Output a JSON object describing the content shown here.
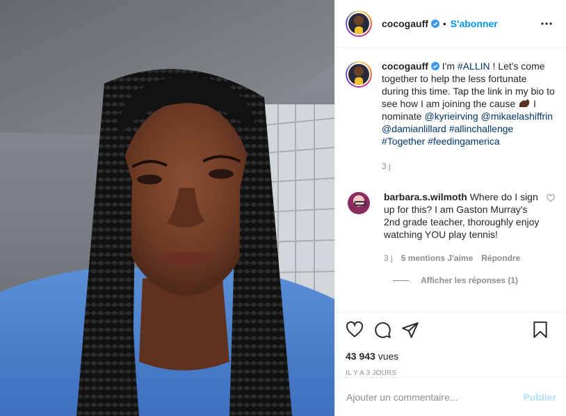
{
  "post": {
    "username": "cocogauff",
    "follow_label": "S'abonner",
    "separator": "•"
  },
  "caption": {
    "username": "cocogauff",
    "text_1": "I'm ",
    "tag_allin": "#ALLIN",
    "text_2": " ! Let's come together to help the less fortunate during this time. Tap the link in my bio to see how I am joining the cause ",
    "text_3": " I nominate ",
    "mention_1": "@kyrieirving",
    "mention_2": "@mikaelashiffrin",
    "mention_3": "@damianlillard",
    "tag_2": "#allinchallenge",
    "tag_3": "#Together",
    "tag_4": "#feedingamerica",
    "age": "3 j"
  },
  "comment": {
    "username": "barbara.s.wilmoth",
    "text": "Where do I sign up for this? I am Gaston Murray's 2nd grade teacher, thoroughly enjoy watching YOU play tennis!",
    "age": "3 j",
    "likes": "5 mentions J'aime",
    "reply_label": "Répondre",
    "view_replies": "Afficher les réponses (1)"
  },
  "stats": {
    "views_count": "43 943",
    "views_label": " vues",
    "posted": "IL Y A 3 JOURS"
  },
  "add_comment": {
    "placeholder": "Ajouter un commentaire...",
    "publish_label": "Publier"
  },
  "icons": {
    "more": "more-options-icon",
    "like": "heart-icon",
    "comment": "comment-icon",
    "share": "share-icon",
    "save": "bookmark-icon",
    "verified": "verified-badge-icon",
    "emoji": "flexed-biceps-emoji"
  },
  "colors": {
    "accent": "#0095f6",
    "publish_disabled": "#b2dffc",
    "link": "#00376b",
    "muted": "#8e8e8e"
  }
}
